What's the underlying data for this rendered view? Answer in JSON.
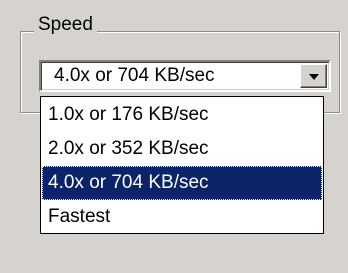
{
  "speed_group": {
    "label": "Speed",
    "selected_value": "4.0x or 704 KB/sec",
    "button_icon": "chevron-down-icon",
    "options": [
      "1.0x or 176 KB/sec",
      "2.0x or 352 KB/sec",
      "4.0x or 704 KB/sec",
      "Fastest"
    ],
    "selected_index": 2,
    "colors": {
      "window_bg": "#d6d3ce",
      "selection_bg": "#0b2469",
      "selection_text": "#ffffff"
    }
  }
}
